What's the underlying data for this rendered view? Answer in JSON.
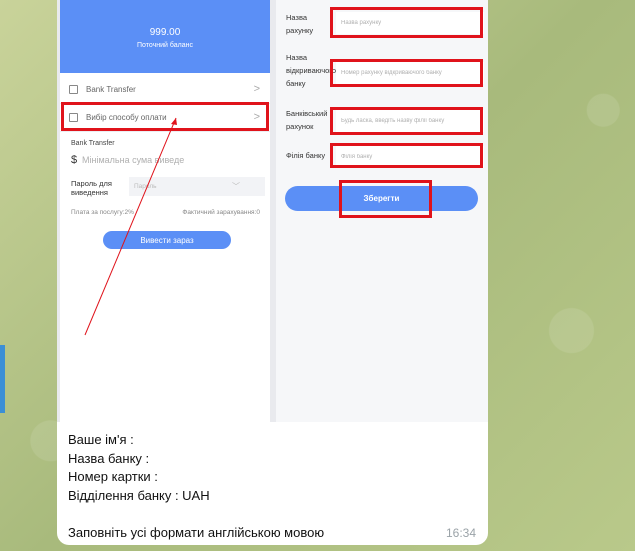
{
  "app": {
    "balance": {
      "amount": "999.00",
      "label": "Поточний баланс"
    },
    "left_menu": [
      {
        "label": "Bank Transfer"
      },
      {
        "label": "Вибір способу оплати"
      }
    ],
    "withdraw": {
      "method_label": "Bank Transfer",
      "currency_symbol": "$",
      "amount_placeholder": "Мінімальна сума виведе",
      "password_label": "Пароль для виведення",
      "password_placeholder": "Пароль",
      "fee_text": "Плата за послугу:2%",
      "actual_text": "Фактичний зарахування:0",
      "submit_label": "Вивести зараз"
    },
    "bank_form": {
      "fields": [
        {
          "label": "Назва рахунку",
          "placeholder": "Назва рахунку"
        },
        {
          "label": "Назва відкриваючого банку",
          "placeholder": "Номер рахунку відкриваючого банку"
        },
        {
          "label": "Банківський рахунок",
          "placeholder": "Будь ласка, введіть назву філії банку"
        },
        {
          "label": "Філія банку",
          "placeholder": "Філія банку"
        }
      ],
      "save_label": "Зберегти"
    }
  },
  "message": {
    "text": "Ваше ім'я :\nНазва банку :\nНомер картки :\nВідділення банку : UAH\n\nЗаповніть усі формати англійською мовою",
    "time": "16:34"
  },
  "colors": {
    "accent": "#5b8ff6",
    "highlight": "#e0131b",
    "wallpaper": "#b7c68b"
  }
}
